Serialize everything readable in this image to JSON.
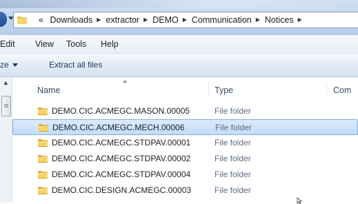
{
  "address_bar": {
    "overflow": "«",
    "crumbs": [
      "Downloads",
      "extractor",
      "DEMO",
      "Communication",
      "Notices"
    ],
    "separator": "▶"
  },
  "menu": {
    "items": [
      "Edit",
      "View",
      "Tools",
      "Help"
    ]
  },
  "command_bar": {
    "organize_partial": "ze",
    "extract_label": "Extract all files"
  },
  "columns": {
    "name": "Name",
    "type": "Type",
    "comment_partial": "Com"
  },
  "files": [
    {
      "name": "DEMO.CIC.ACMEGC.MASON.00005",
      "type": "File folder",
      "selected": false
    },
    {
      "name": "DEMO.CIC.ACMEGC.MECH.00006",
      "type": "File folder",
      "selected": true
    },
    {
      "name": "DEMO.CIC.ACMEGC.STDPAV.00001",
      "type": "File folder",
      "selected": false
    },
    {
      "name": "DEMO.CIC.ACMEGC.STDPAV.00002",
      "type": "File folder",
      "selected": false
    },
    {
      "name": "DEMO.CIC.ACMEGC.STDPAV.00004",
      "type": "File folder",
      "selected": false
    },
    {
      "name": "DEMO.CIC.DESIGN.ACMEGC.00003",
      "type": "File folder",
      "selected": false
    }
  ],
  "colors": {
    "selection_fill": "#c1dcfc",
    "selection_border": "#84acdd",
    "folder_yellow": "#f2c94c"
  }
}
